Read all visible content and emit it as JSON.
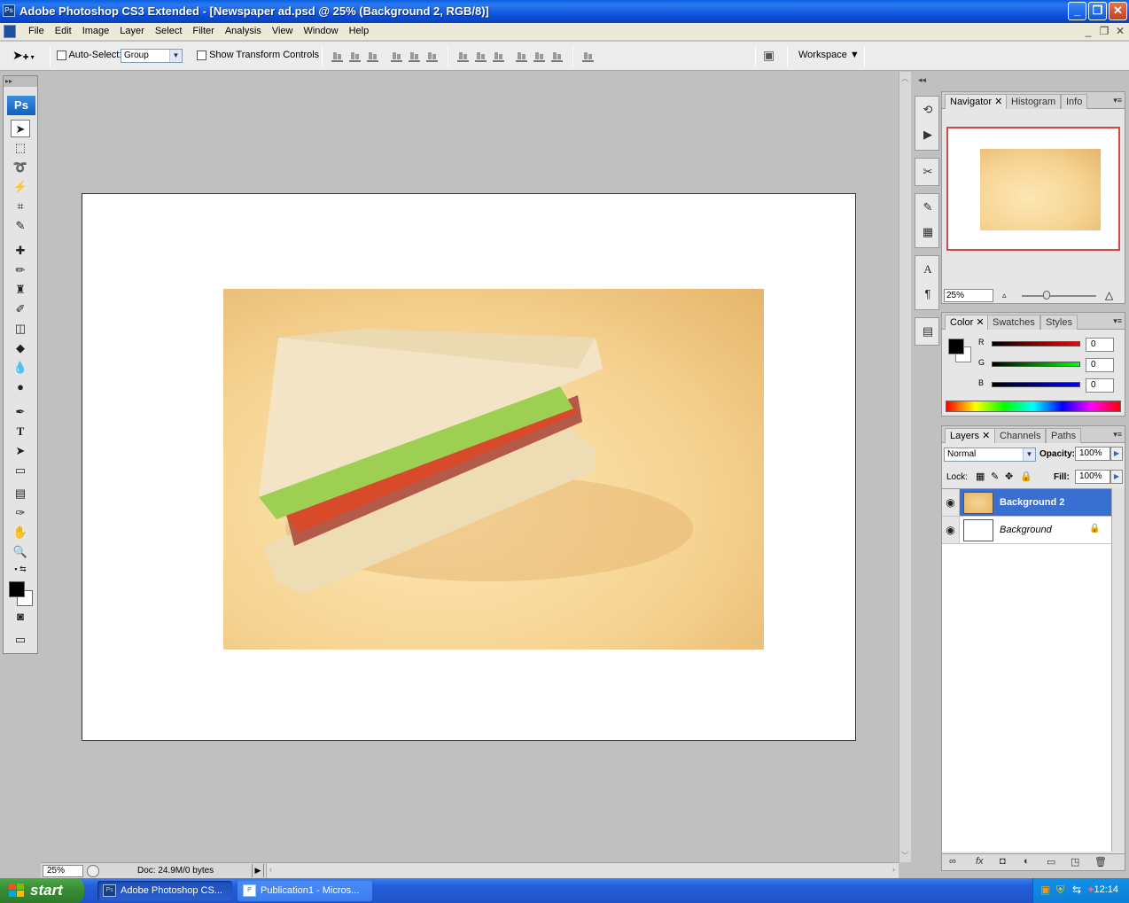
{
  "window": {
    "title": "Adobe Photoshop CS3 Extended - [Newspaper ad.psd @ 25% (Background 2, RGB/8)]",
    "app_icon": "Ps",
    "controls": {
      "minimize": "_",
      "restore": "❐",
      "close": "✕"
    }
  },
  "menu": {
    "items": [
      "File",
      "Edit",
      "Image",
      "Layer",
      "Select",
      "Filter",
      "Analysis",
      "View",
      "Window",
      "Help"
    ]
  },
  "options_bar": {
    "auto_select_label": "Auto-Select:",
    "auto_select_value": "Group",
    "transform_label": "Show Transform Controls",
    "workspace_label": "Workspace"
  },
  "toolbox": {
    "logo": "Ps"
  },
  "status_bar": {
    "zoom": "25%",
    "doc_info": "Doc: 24.9M/0 bytes"
  },
  "navigator": {
    "tabs": [
      "Navigator",
      "Histogram",
      "Info"
    ],
    "zoom": "25%"
  },
  "color_panel": {
    "tabs": [
      "Color",
      "Swatches",
      "Styles"
    ],
    "channels": [
      {
        "label": "R",
        "value": "0"
      },
      {
        "label": "G",
        "value": "0"
      },
      {
        "label": "B",
        "value": "0"
      }
    ]
  },
  "layers_panel": {
    "tabs": [
      "Layers",
      "Channels",
      "Paths"
    ],
    "blend_mode": "Normal",
    "opacity_label": "Opacity:",
    "opacity": "100%",
    "lock_label": "Lock:",
    "fill_label": "Fill:",
    "fill": "100%",
    "layers": [
      {
        "name": "Background 2"
      },
      {
        "name": "Background"
      }
    ]
  },
  "taskbar": {
    "start": "start",
    "tasks": [
      "Adobe Photoshop CS...",
      "Publication1 - Micros..."
    ],
    "clock": "12:14"
  },
  "colors": {
    "selection": "#3a6fd2",
    "titlebar": "#0b4fd6",
    "start_green": "#3a8e36"
  }
}
